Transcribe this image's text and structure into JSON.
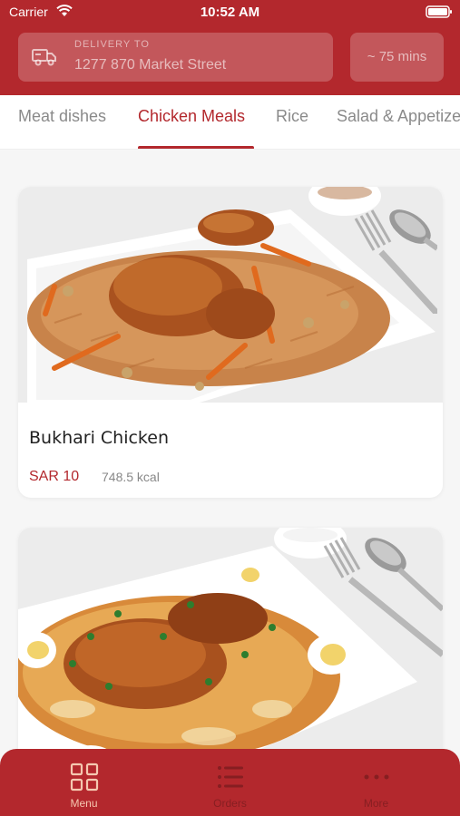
{
  "status_bar": {
    "carrier": "Carrier",
    "time": "10:52 AM"
  },
  "header": {
    "delivery_label": "DELIVERY TO",
    "delivery_address": "1277 870 Market Street",
    "eta": "~ 75 mins"
  },
  "tabs": [
    {
      "label": "Meat dishes",
      "active": false
    },
    {
      "label": "Chicken Meals",
      "active": true
    },
    {
      "label": "Rice",
      "active": false
    },
    {
      "label": "Salad & Appetizers",
      "active": false
    }
  ],
  "items": [
    {
      "name": "Bukhari Chicken",
      "price": "SAR 10",
      "kcal": "748.5 kcal",
      "image_icon": "bukhari-chicken-photo"
    },
    {
      "name": "",
      "price": "",
      "kcal": "",
      "image_icon": "chicken-biryani-photo"
    }
  ],
  "bottom_nav": [
    {
      "label": "Menu",
      "icon": "grid-icon",
      "active": true
    },
    {
      "label": "Orders",
      "icon": "list-icon",
      "active": false
    },
    {
      "label": "More",
      "icon": "more-icon",
      "active": false
    }
  ],
  "colors": {
    "brand": "#b3282d",
    "active_nav": "#f5c8b0"
  }
}
